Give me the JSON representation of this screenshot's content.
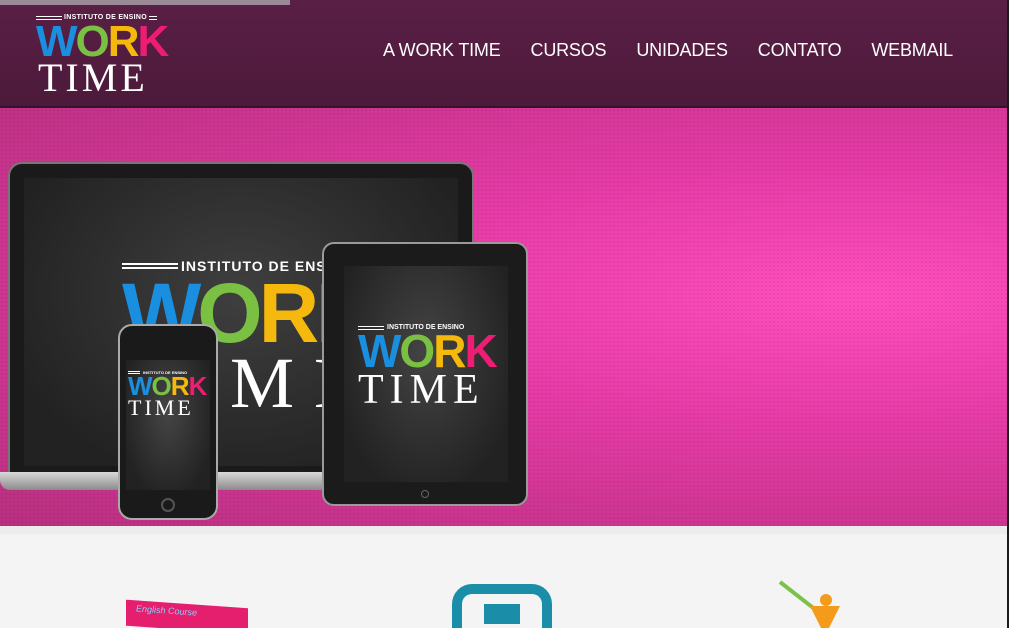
{
  "brand": {
    "kicker": "INSTITUTO DE ENSINO",
    "work": [
      "W",
      "O",
      "R",
      "K"
    ],
    "time": "TIME",
    "colors": {
      "w": "#1a8fe0",
      "o": "#7ac143",
      "r": "#f5b80d",
      "k": "#ec1d72",
      "header": "#4c1a3b",
      "hero": "#e63ba6"
    }
  },
  "nav": {
    "items": [
      "A WORK TIME",
      "CURSOS",
      "UNIDADES",
      "CONTATO",
      "WEBMAIL"
    ]
  },
  "bottom": {
    "english_label": "English Course"
  },
  "icons": [
    "laptop-icon",
    "tablet-icon",
    "smartphone-icon",
    "shield-icon",
    "person-arrow-icon"
  ]
}
